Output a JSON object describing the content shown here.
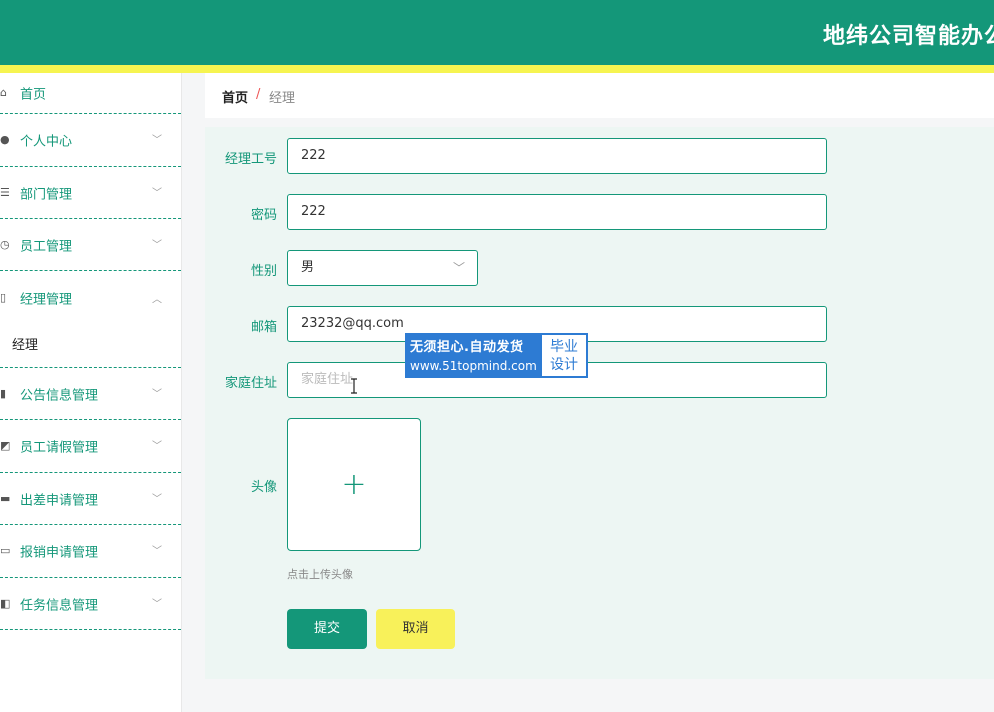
{
  "header": {
    "title": "地纬公司智能办公"
  },
  "sidebar": {
    "items": [
      {
        "label": "首页",
        "icon": "home-icon"
      },
      {
        "label": "个人中心",
        "icon": "user-icon"
      },
      {
        "label": "部门管理",
        "icon": "list-icon"
      },
      {
        "label": "员工管理",
        "icon": "clock-icon"
      },
      {
        "label": "经理管理",
        "icon": "device-icon",
        "sub": "经理"
      },
      {
        "label": "公告信息管理",
        "icon": "bar-chart-icon"
      },
      {
        "label": "员工请假管理",
        "icon": "line-chart-icon"
      },
      {
        "label": "出差申请管理",
        "icon": "tray-icon"
      },
      {
        "label": "报销申请管理",
        "icon": "monitor-icon"
      },
      {
        "label": "任务信息管理",
        "icon": "video-icon"
      }
    ]
  },
  "breadcrumb": {
    "home": "首页",
    "separator": "/",
    "current": "经理"
  },
  "form": {
    "manager_id": {
      "label": "经理工号",
      "value": "222"
    },
    "password": {
      "label": "密码",
      "value": "222"
    },
    "gender": {
      "label": "性别",
      "value": "男"
    },
    "email": {
      "label": "邮箱",
      "value": "23232@qq.com"
    },
    "address": {
      "label": "家庭住址",
      "placeholder": "家庭住址"
    },
    "avatar": {
      "label": "头像",
      "tip": "点击上传头像"
    },
    "submit_label": "提交",
    "cancel_label": "取消"
  },
  "watermark": {
    "line1": "无须担心.自动发货",
    "line2": "www.51topmind.com",
    "badge_line1": "毕业",
    "badge_line2": "设计"
  },
  "colors": {
    "primary": "#149779",
    "accent": "#f6f450",
    "panel": "#edf6f3"
  }
}
